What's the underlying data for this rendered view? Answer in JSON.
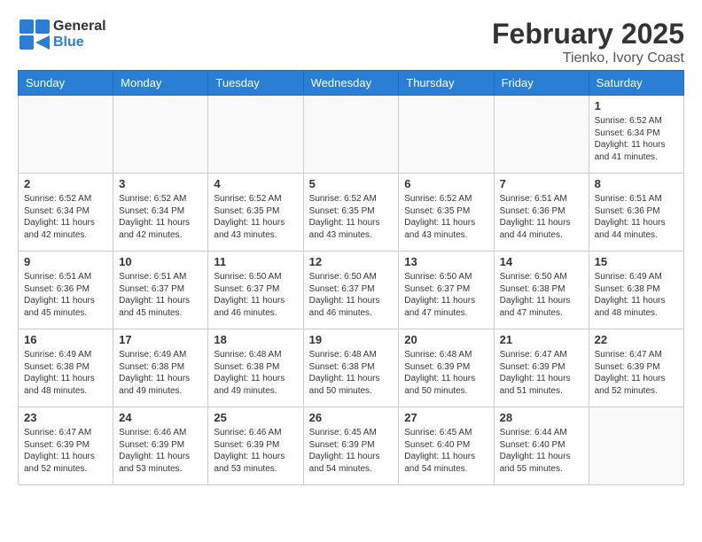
{
  "header": {
    "logo_line1": "General",
    "logo_line2": "Blue",
    "month_title": "February 2025",
    "location": "Tienko, Ivory Coast"
  },
  "days_of_week": [
    "Sunday",
    "Monday",
    "Tuesday",
    "Wednesday",
    "Thursday",
    "Friday",
    "Saturday"
  ],
  "weeks": [
    {
      "days": [
        {
          "number": "",
          "info": ""
        },
        {
          "number": "",
          "info": ""
        },
        {
          "number": "",
          "info": ""
        },
        {
          "number": "",
          "info": ""
        },
        {
          "number": "",
          "info": ""
        },
        {
          "number": "",
          "info": ""
        },
        {
          "number": "1",
          "info": "Sunrise: 6:52 AM\nSunset: 6:34 PM\nDaylight: 11 hours\nand 41 minutes."
        }
      ]
    },
    {
      "days": [
        {
          "number": "2",
          "info": "Sunrise: 6:52 AM\nSunset: 6:34 PM\nDaylight: 11 hours\nand 42 minutes."
        },
        {
          "number": "3",
          "info": "Sunrise: 6:52 AM\nSunset: 6:34 PM\nDaylight: 11 hours\nand 42 minutes."
        },
        {
          "number": "4",
          "info": "Sunrise: 6:52 AM\nSunset: 6:35 PM\nDaylight: 11 hours\nand 43 minutes."
        },
        {
          "number": "5",
          "info": "Sunrise: 6:52 AM\nSunset: 6:35 PM\nDaylight: 11 hours\nand 43 minutes."
        },
        {
          "number": "6",
          "info": "Sunrise: 6:52 AM\nSunset: 6:35 PM\nDaylight: 11 hours\nand 43 minutes."
        },
        {
          "number": "7",
          "info": "Sunrise: 6:51 AM\nSunset: 6:36 PM\nDaylight: 11 hours\nand 44 minutes."
        },
        {
          "number": "8",
          "info": "Sunrise: 6:51 AM\nSunset: 6:36 PM\nDaylight: 11 hours\nand 44 minutes."
        }
      ]
    },
    {
      "days": [
        {
          "number": "9",
          "info": "Sunrise: 6:51 AM\nSunset: 6:36 PM\nDaylight: 11 hours\nand 45 minutes."
        },
        {
          "number": "10",
          "info": "Sunrise: 6:51 AM\nSunset: 6:37 PM\nDaylight: 11 hours\nand 45 minutes."
        },
        {
          "number": "11",
          "info": "Sunrise: 6:50 AM\nSunset: 6:37 PM\nDaylight: 11 hours\nand 46 minutes."
        },
        {
          "number": "12",
          "info": "Sunrise: 6:50 AM\nSunset: 6:37 PM\nDaylight: 11 hours\nand 46 minutes."
        },
        {
          "number": "13",
          "info": "Sunrise: 6:50 AM\nSunset: 6:37 PM\nDaylight: 11 hours\nand 47 minutes."
        },
        {
          "number": "14",
          "info": "Sunrise: 6:50 AM\nSunset: 6:38 PM\nDaylight: 11 hours\nand 47 minutes."
        },
        {
          "number": "15",
          "info": "Sunrise: 6:49 AM\nSunset: 6:38 PM\nDaylight: 11 hours\nand 48 minutes."
        }
      ]
    },
    {
      "days": [
        {
          "number": "16",
          "info": "Sunrise: 6:49 AM\nSunset: 6:38 PM\nDaylight: 11 hours\nand 48 minutes."
        },
        {
          "number": "17",
          "info": "Sunrise: 6:49 AM\nSunset: 6:38 PM\nDaylight: 11 hours\nand 49 minutes."
        },
        {
          "number": "18",
          "info": "Sunrise: 6:48 AM\nSunset: 6:38 PM\nDaylight: 11 hours\nand 49 minutes."
        },
        {
          "number": "19",
          "info": "Sunrise: 6:48 AM\nSunset: 6:38 PM\nDaylight: 11 hours\nand 50 minutes."
        },
        {
          "number": "20",
          "info": "Sunrise: 6:48 AM\nSunset: 6:39 PM\nDaylight: 11 hours\nand 50 minutes."
        },
        {
          "number": "21",
          "info": "Sunrise: 6:47 AM\nSunset: 6:39 PM\nDaylight: 11 hours\nand 51 minutes."
        },
        {
          "number": "22",
          "info": "Sunrise: 6:47 AM\nSunset: 6:39 PM\nDaylight: 11 hours\nand 52 minutes."
        }
      ]
    },
    {
      "days": [
        {
          "number": "23",
          "info": "Sunrise: 6:47 AM\nSunset: 6:39 PM\nDaylight: 11 hours\nand 52 minutes."
        },
        {
          "number": "24",
          "info": "Sunrise: 6:46 AM\nSunset: 6:39 PM\nDaylight: 11 hours\nand 53 minutes."
        },
        {
          "number": "25",
          "info": "Sunrise: 6:46 AM\nSunset: 6:39 PM\nDaylight: 11 hours\nand 53 minutes."
        },
        {
          "number": "26",
          "info": "Sunrise: 6:45 AM\nSunset: 6:39 PM\nDaylight: 11 hours\nand 54 minutes."
        },
        {
          "number": "27",
          "info": "Sunrise: 6:45 AM\nSunset: 6:40 PM\nDaylight: 11 hours\nand 54 minutes."
        },
        {
          "number": "28",
          "info": "Sunrise: 6:44 AM\nSunset: 6:40 PM\nDaylight: 11 hours\nand 55 minutes."
        },
        {
          "number": "",
          "info": ""
        }
      ]
    }
  ]
}
